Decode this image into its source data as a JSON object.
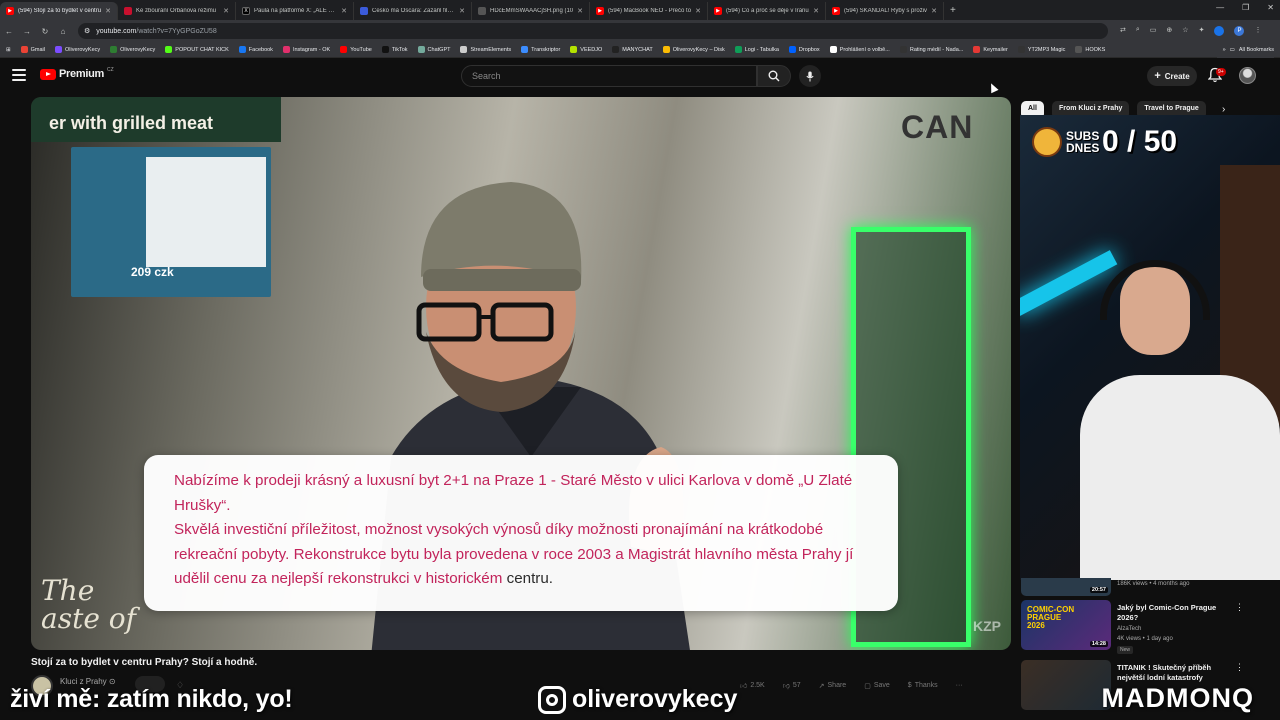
{
  "browser": {
    "tabs": [
      {
        "title": "(594) Stojí za to bydlet v centru",
        "icon": "youtube-icon",
        "color": "#ff0000",
        "active": true
      },
      {
        "title": "Ke zbourání Orbánova režimu",
        "icon": "news-icon",
        "color": "#c8102e"
      },
      {
        "title": "Paula na platformě X: „ALE PAV",
        "icon": "x-icon",
        "color": "#000000"
      },
      {
        "title": "Česko má Oscara: Zazářil film o",
        "icon": "site-icon",
        "color": "#3b5bdb"
      },
      {
        "title": "HDcEMmSWAAACjSH.png (10",
        "icon": "image-icon",
        "color": "#555555"
      },
      {
        "title": "(594) MacBook NEO - Prečo to",
        "icon": "youtube-icon",
        "color": "#ff0000"
      },
      {
        "title": "(594) Co a proč se děje v Íránu",
        "icon": "youtube-icon",
        "color": "#ff0000"
      },
      {
        "title": "(594) SKANDÁL! Ryby s proživ",
        "icon": "youtube-icon",
        "color": "#ff0000"
      }
    ],
    "url_domain": "youtube.com",
    "url_path": "/watch?v=7YyGPGoZU58",
    "bookmarks": [
      {
        "label": "Gmail",
        "color": "#ea4335"
      },
      {
        "label": "OliverovyKecy",
        "color": "#7c4dff"
      },
      {
        "label": "OliverovyKecy",
        "color": "#2e7d32"
      },
      {
        "label": "POPOUT CHAT KICK",
        "color": "#53fc18"
      },
      {
        "label": "Facebook",
        "color": "#1877f2"
      },
      {
        "label": "Instagram - OK",
        "color": "#e1306c"
      },
      {
        "label": "YouTube",
        "color": "#ff0000"
      },
      {
        "label": "TikTok",
        "color": "#111111"
      },
      {
        "label": "ChatGPT",
        "color": "#74aa9c"
      },
      {
        "label": "StreamElements",
        "color": "#cccccc"
      },
      {
        "label": "Transkriptor",
        "color": "#3c8dff"
      },
      {
        "label": "VEEDJO",
        "color": "#b4e200"
      },
      {
        "label": "MANYCHAT",
        "color": "#222222"
      },
      {
        "label": "OliverovyKecy – Disk",
        "color": "#fbbc04"
      },
      {
        "label": "Logi - Tabulka",
        "color": "#0f9d58"
      },
      {
        "label": "Dropbox",
        "color": "#0061ff"
      },
      {
        "label": "Prohlášení o volbě...",
        "color": "#ffffff"
      },
      {
        "label": "Rating médií - Nada...",
        "color": "#333333"
      },
      {
        "label": "Keymailer",
        "color": "#e53935"
      },
      {
        "label": "YT2MP3 Magic",
        "color": "#333333"
      },
      {
        "label": "HOOKS",
        "color": "#555555"
      }
    ],
    "all_bookmarks": "All Bookmarks",
    "profile_initial": "P"
  },
  "youtube": {
    "brand": "Premium",
    "country": "CZ",
    "search_placeholder": "Search",
    "create_label": "Create",
    "notification_count": "9+",
    "video": {
      "sign_text": "er with grilled meat",
      "menu_price": "209 czk",
      "store_sign": "CAN",
      "taste_text": "The\naste of",
      "watermark": "KZP",
      "caption_line1": "Nabízíme k prodeji krásný a luxusní byt 2+1 na Praze 1 - Staré Město v ulici Karlova v domě „U Zlaté Hrušky“.",
      "caption_line2_pink": "Skvělá investiční příležitost, možnost vysokých výnosů díky možnosti pronajímání na krátkodobé rekreační pobyty. Rekonstrukce bytu byla provedena v roce 2003 a Magistrát hlavního města Prahy jí udělil cenu za nejlepší rekonstrukci v historickém",
      "caption_line2_dark": " centru."
    },
    "video_title": "Stojí za to bydlet v centru Prahy? Stojí a hodně.",
    "channel_name": "Kluci z Prahy",
    "actions": [
      {
        "label": "2.5K",
        "icon": "like-icon"
      },
      {
        "label": "57",
        "icon": "dislike-icon"
      },
      {
        "label": "Share",
        "icon": "share-icon"
      },
      {
        "label": "Save",
        "icon": "save-icon"
      },
      {
        "label": "Thanks",
        "icon": "thanks-icon"
      },
      {
        "label": "···",
        "icon": "more-icon"
      }
    ],
    "chips": [
      "All",
      "From Kluci z Prahy",
      "Travel to Prague"
    ],
    "recommendations": [
      {
        "title": "",
        "meta1": "186K views • 4 months ago",
        "meta2": "",
        "duration": "20:57",
        "thumb": "#2a3b4a"
      },
      {
        "title": "Jaký byl Comic-Con Prague 2026?",
        "meta1": "AlzaTech",
        "meta2": "4K views • 1 day ago",
        "badge": "New",
        "duration": "14:28",
        "thumb": "#1b3566"
      },
      {
        "title": "TITANIK ! Skutečný příběh největší lodní katastrofy",
        "meta1": "",
        "meta2": "",
        "duration": "",
        "thumb": "#3b2e25"
      }
    ]
  },
  "webcam": {
    "subs_label": "SUBS DNES",
    "subs_value": "0 / 50"
  },
  "overlay": {
    "left_text": "živí mě: zatím nikdo, yo!",
    "instagram_handle": "oliverovykecy",
    "right_text": "MADMONQ"
  }
}
